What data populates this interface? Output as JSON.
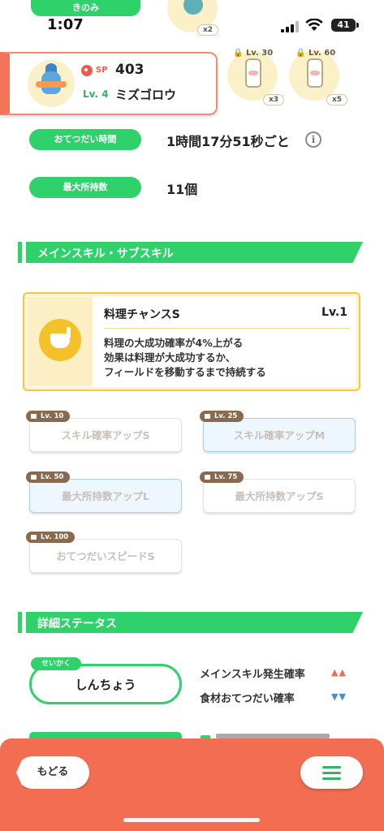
{
  "status_bar": {
    "tag": "きのみ",
    "time": "1:07",
    "battery": "41"
  },
  "top_items": {
    "berry_count": "x2",
    "ingredients": [
      {
        "level": "Lv. 30",
        "count": "x3"
      },
      {
        "level": "Lv. 60",
        "count": "x5"
      }
    ]
  },
  "pokemon": {
    "sp_label": "SP",
    "sp_value": "403",
    "level": "Lv. 4",
    "name": "ミズゴロウ"
  },
  "info": {
    "help_time_label": "おてつだい時間",
    "help_time_value": "1時間17分51秒ごと",
    "info_button": "i",
    "max_carry_label": "最大所持数",
    "max_carry_value": "11個"
  },
  "skills_section": {
    "title": "メインスキル・サブスキル",
    "main_skill": {
      "name": "料理チャンスS",
      "level": "Lv.1",
      "description": [
        "料理の大成功確率が4%上がる",
        "効果は料理が大成功するか、",
        "フィールドを移動するまで持続する"
      ]
    },
    "sub_skills": [
      {
        "lock": "Lv. 10",
        "name": "スキル確率アップS",
        "style": "normal"
      },
      {
        "lock": "Lv. 25",
        "name": "スキル確率アップM",
        "style": "blue"
      },
      {
        "lock": "Lv. 50",
        "name": "最大所持数アップL",
        "style": "blue"
      },
      {
        "lock": "Lv. 75",
        "name": "最大所持数アップS",
        "style": "normal"
      },
      {
        "lock": "Lv. 100",
        "name": "おてつだいスピードS",
        "style": "normal"
      }
    ]
  },
  "detail_section": {
    "title": "詳細ステータス",
    "personality_tag": "せいかく",
    "personality": "しんちょう",
    "stats": [
      {
        "label": "メインスキル発生確率",
        "arrows": "▲▲",
        "direction": "up"
      },
      {
        "label": "食材おてつだい確率",
        "arrows": "▼▼",
        "direction": "down"
      }
    ]
  },
  "bottom_bar": {
    "back_label": "もどる",
    "menu_icon": "hamburger-menu-icon"
  },
  "colors": {
    "accent_green": "#2fd26a",
    "bottom_bar": "#f36d52",
    "main_skill_border": "#f5c64a",
    "up_arrow": "#f26a4f",
    "down_arrow": "#3a8fe0"
  }
}
